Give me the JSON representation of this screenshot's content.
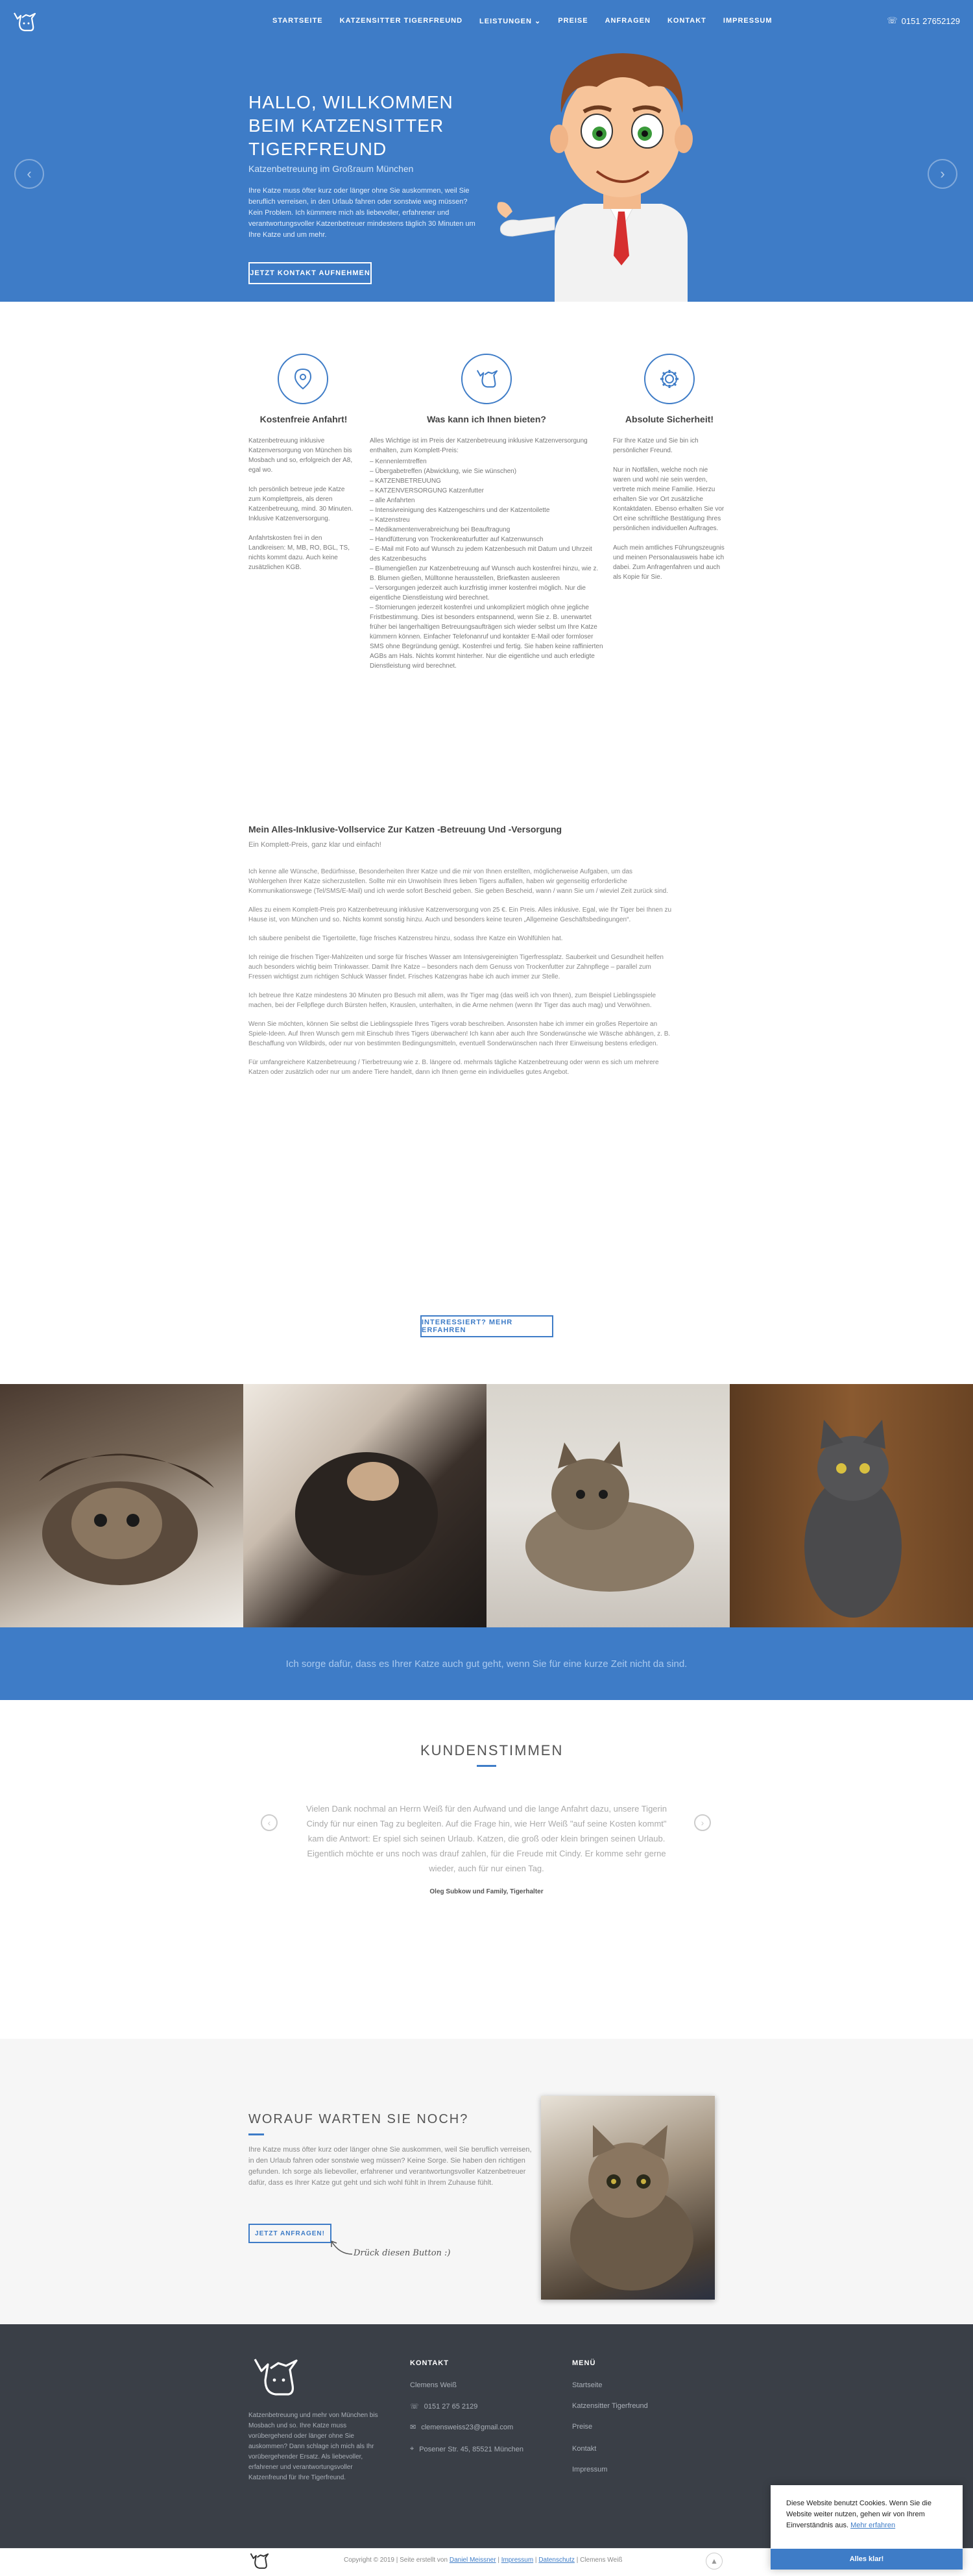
{
  "colors": {
    "brand_blue": "#3e7cc7",
    "footer_bg": "#3a3f47",
    "text": "#666666"
  },
  "nav": {
    "items": [
      "STARTSEITE",
      "KATZENSITTER TIGERFREUND",
      "LEISTUNGEN",
      "PREISE",
      "ANFRAGEN",
      "KONTAKT",
      "IMPRESSUM"
    ],
    "dropdown_icon": "chevron-down-icon",
    "phone": "0151 27652129"
  },
  "hero": {
    "title": "HALLO, WILLKOMMEN BEIM KATZENSITTER TIGERFREUND",
    "subtitle": "Katzenbetreuung im Großraum München",
    "text": "Ihre Katze muss öfter kurz oder länger ohne Sie auskommen, weil Sie beruflich verreisen, in den Urlaub fahren oder sonstwie weg müssen? Kein Problem. Ich kümmere mich als liebevoller, erfahrener und verantwortungsvoller Katzenbetreuer mindestens täglich 30 Minuten um Ihre Katze und um mehr.",
    "button": "JETZT KONTAKT AUFNEHMEN",
    "prev": "‹",
    "next": "›"
  },
  "features": [
    {
      "icon": "map-pin-icon",
      "title": "Kostenfreie Anfahrt!",
      "paragraphs": [
        "Katzenbetreuung inklusive Katzenversorgung von München bis Mosbach und so, erfolgreich der A8, egal wo.",
        "Ich persönlich betreue jede Katze zum Komplettpreis, als deren Katzenbetreuung, mind. 30 Minuten. Inklusive Katzenversorgung.",
        "Anfahrtskosten frei in den Landkreisen: M, MB, RO, BGL, TS, nichts kommt dazu. Auch keine zusätzlichen KGB."
      ]
    },
    {
      "icon": "cat-icon",
      "title": "Was kann ich Ihnen bieten?",
      "intro": "Alles Wichtige ist im Preis der Katzenbetreuung inklusive Katzenversorgung enthalten, zum Komplett-Preis:",
      "items": [
        "– Kennenlerntreffen",
        "– Übergabetreffen (Abwicklung, wie Sie wünschen)",
        "– KATZENBETREUUNG",
        "– KATZENVERSORGUNG Katzenfutter",
        "– alle Anfahrten",
        "– Intensivreinigung des Katzengeschirrs und der Katzentoilette",
        "– Katzenstreu",
        "– Medikamentenverabreichung bei Beauftragung",
        "– Handfütterung von Trockenkreaturfutter auf Katzenwunsch",
        "– E-Mail mit Foto auf Wunsch zu jedem Katzenbesuch mit Datum und Uhrzeit des Katzenbesuchs",
        "– Blumengießen zur Katzenbetreuung auf Wunsch auch kostenfrei hinzu, wie z. B. Blumen gießen, Mülltonne herausstellen, Briefkasten ausleeren",
        "– Versorgungen jederzeit auch kurzfristig immer kostenfrei möglich. Nur die eigentliche Dienstleistung wird berechnet.",
        "– Stornierungen jederzeit kostenfrei und unkompliziert möglich ohne jegliche Fristbestimmung. Dies ist besonders entspannend, wenn Sie z. B. unerwartet früher bei langerhaltigen Betreuungsaufträgen sich wieder selbst um Ihre Katze kümmern können. Einfacher Telefonanruf und kontakter E-Mail oder formloser SMS ohne Begründung genügt. Kostenfrei und fertig. Sie haben keine raffinierten AGBs am Hals. Nichts kommt hinterher. Nur die eigentliche und auch erledigte Dienstleistung wird berechnet."
      ]
    },
    {
      "icon": "gear-icon",
      "title": "Absolute Sicherheit!",
      "paragraphs": [
        "Für Ihre Katze und Sie bin ich persönlicher Freund.",
        "Nur in Notfällen, welche noch nie waren und wohl nie sein werden, vertrete mich meine Familie. Hierzu erhalten Sie vor Ort zusätzliche Kontaktdaten. Ebenso erhalten Sie vor Ort eine schriftliche Bestätigung Ihres persönlichen individuellen Auftrages.",
        "Auch mein amtliches Führungszeugnis und meinen Personalausweis habe ich dabei. Zum Anfragenfahren und auch als Kopie für Sie."
      ]
    }
  ],
  "service": {
    "title": "Mein Alles-Inklusive-Vollservice Zur Katzen -Betreuung Und -Versorgung",
    "subtitle": "Ein Komplett-Preis, ganz klar und einfach!",
    "paragraphs": [
      "Ich kenne alle Wünsche, Bedürfnisse, Besonderheiten Ihrer Katze und die mir von Ihnen erstellten, möglicherweise Aufgaben, um das Wohlergehen Ihrer Katze sicherzustellen. Sollte mir ein Unwohlsein Ihres lieben Tigers auffallen, haben wir gegenseitig erforderliche Kommunikationswege (Tel/SMS/E-Mail) und ich werde sofort Bescheid geben. Sie geben Bescheid, wann / wann Sie um / wieviel Zeit zurück sind.",
      "Alles zu einem Komplett-Preis pro Katzenbetreuung inklusive Katzenversorgung von 25 €. Ein Preis. Alles inklusive. Egal, wie Ihr Tiger bei Ihnen zu Hause ist, von München und so. Nichts kommt sonstig hinzu. Auch und besonders keine teuren „Allgemeine Geschäftsbedingungen“.",
      "Ich säubere penibelst die Tigertoilette, füge frisches Katzenstreu hinzu, sodass Ihre Katze ein Wohlfühlen hat.",
      "Ich reinige die frischen Tiger-Mahlzeiten und sorge für frisches Wasser am Intensivgereinigten Tigerfressplatz. Sauberkeit und Gesundheit helfen auch besonders wichtig beim Trinkwasser. Damit Ihre Katze – besonders nach dem Genuss von Trockenfutter zur Zahnpflege – parallel zum Fressen wichtigst zum richtigen Schluck Wasser findet. Frisches Katzengras habe ich auch immer zur Stelle.",
      "Ich betreue Ihre Katze mindestens 30 Minuten pro Besuch mit allem, was Ihr Tiger mag (das weiß ich von Ihnen), zum Beispiel Lieblingsspiele machen, bei der Fellpflege durch Bürsten helfen, Krauslen, unterhalten, in die Arme nehmen (wenn Ihr Tiger das auch mag) und Verwöhnen.",
      "Wenn Sie möchten, können Sie selbst die Lieblingsspiele Ihres Tigers vorab beschreiben. Ansonsten habe ich immer ein großes Repertoire an Spiele-Ideen. Auf Ihren Wunsch gern mit Einschub Ihres Tigers überwachen! Ich kann aber auch Ihre Sonderwünsche wie Wäsche abhängen, z. B. Beschaffung von Wildbirds, oder nur von bestimmten Bedingungsmitteln, eventuell Sonderwünschen nach Ihrer Einweisung bestens erledigen.",
      "Für umfangreichere Katzenbetreuung / Tierbetreuung wie z. B. längere od. mehrmals tägliche Katzenbetreuung oder wenn es sich um mehrere Katzen oder zusätzlich oder nur um andere Tiere handelt, dann ich Ihnen gerne ein individuelles gutes Angebot."
    ],
    "button": "INTERESSIERT? MEHR ERFAHREN"
  },
  "band_text": "Ich sorge dafür, dass es Ihrer Katze auch gut geht, wenn Sie für eine kurze Zeit nicht da sind.",
  "testimonials": {
    "title": "KUNDENSTIMMEN",
    "quote": "Vielen Dank nochmal an Herrn Weiß für den Aufwand und die lange Anfahrt dazu, unsere Tigerin Cindy für nur einen Tag zu begleiten. Auf die Frage hin, wie Herr Weiß \"auf seine Kosten kommt\" kam die Antwort: Er spiel sich seinen Urlaub. Katzen, die groß oder klein bringen seinen Urlaub. Eigentlich möchte er uns noch was drauf zahlen, für die Freude mit Cindy. Er komme sehr gerne wieder, auch für nur einen Tag.",
    "author": "Oleg Subkow und Family, Tigerhalter",
    "prev": "‹",
    "next": "›"
  },
  "cta": {
    "title": "WORAUF WARTEN SIE NOCH?",
    "text": "Ihre Katze muss öfter kurz oder länger ohne Sie auskommen, weil Sie beruflich verreisen, in den Urlaub fahren oder sonstwie weg müssen? Keine Sorge. Sie haben den richtigen gefunden. Ich sorge als liebevoller, erfahrener und verantwortungsvoller Katzenbetreuer dafür, dass es Ihrer Katze gut geht und sich wohl fühlt in Ihrem Zuhause fühlt.",
    "button": "JETZT ANFRAGEN!",
    "hand_note": "Drück diesen Button :)"
  },
  "footer": {
    "about": "Katzenbetreuung und mehr von München bis Mosbach und so. Ihre Katze muss vorübergehend oder länger ohne Sie auskommen? Dann schlage ich mich als Ihr vorübergehender Ersatz. Als liebevoller, erfahrener und verantwortungsvoller Katzenfreund für Ihre Tigerfreund.",
    "contact_title": "KONTAKT",
    "contact": [
      {
        "icon": "user-icon",
        "text": "Clemens Weiß"
      },
      {
        "icon": "phone-icon",
        "text": "0151 27 65 2129"
      },
      {
        "icon": "mail-icon",
        "text": "clemensweiss23@gmail.com"
      },
      {
        "icon": "location-icon",
        "text": "Posener Str. 45, 85521 München"
      }
    ],
    "menu_title": "MENÜ",
    "menu": [
      "Startseite",
      "Katzensitter Tigerfreund",
      "Preise",
      "Kontakt",
      "Impressum"
    ],
    "copyright_prefix": "Copyright © 2019 | Seite erstellt von",
    "copyright_author": "Daniel Meissner",
    "links": [
      "Impressum",
      "Datenschutz"
    ],
    "copyright_suffix": "| Clemens Weiß"
  },
  "cookie": {
    "text": "Diese Website benutzt Cookies. Wenn Sie die Website weiter nutzen, gehen wir von Ihrem Einverständnis aus.",
    "link": "Mehr erfahren",
    "button": "Alles klar!"
  }
}
